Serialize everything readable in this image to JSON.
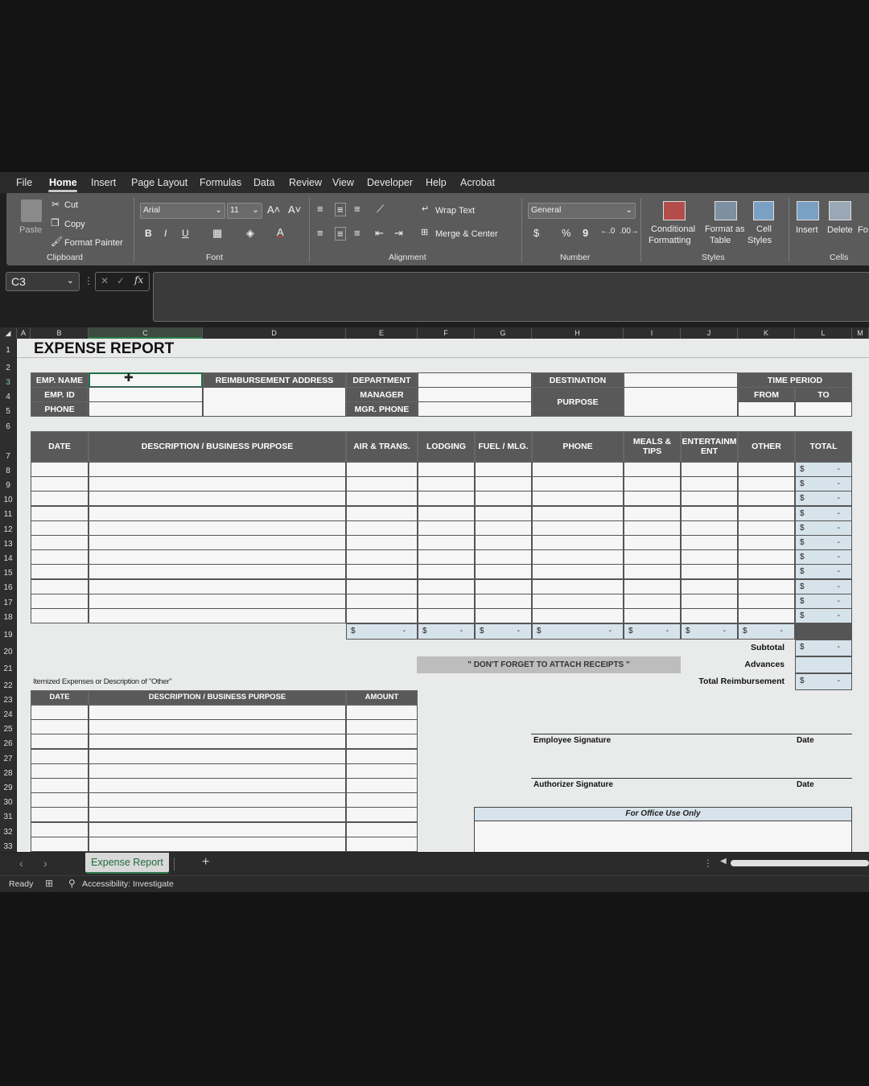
{
  "menu": [
    "File",
    "Home",
    "Insert",
    "Page Layout",
    "Formulas",
    "Data",
    "Review",
    "View",
    "Developer",
    "Help",
    "Acrobat"
  ],
  "ribbon": {
    "clipboard": {
      "paste": "Paste",
      "cut": "Cut",
      "copy": "Copy",
      "format_painter": "Format Painter",
      "group": "Clipboard"
    },
    "font": {
      "name": "Arial",
      "size": "11",
      "bold": "B",
      "italic": "I",
      "underline": "U",
      "group": "Font"
    },
    "alignment": {
      "wrap": "Wrap Text",
      "merge": "Merge & Center",
      "group": "Alignment"
    },
    "number": {
      "format": "General",
      "currency": "$",
      "percent": "%",
      "comma": "9",
      "group": "Number"
    },
    "styles": {
      "conditional": "Conditional",
      "conditional2": "Formatting",
      "format_table": "Format as",
      "format_table2": "Table",
      "cell_styles": "Cell",
      "cell_styles2": "Styles",
      "group": "Styles"
    },
    "cells": {
      "insert": "Insert",
      "delete": "Delete",
      "format": "Fo",
      "group": "Cells"
    }
  },
  "formula_bar": {
    "name_box": "C3",
    "fx": "fx",
    "value": ""
  },
  "columns": [
    "A",
    "B",
    "C",
    "D",
    "E",
    "F",
    "G",
    "H",
    "I",
    "J",
    "K",
    "L",
    "M"
  ],
  "rows": [
    "1",
    "2",
    "3",
    "4",
    "5",
    "6",
    "7",
    "8",
    "9",
    "10",
    "11",
    "12",
    "13",
    "14",
    "15",
    "16",
    "17",
    "18",
    "19",
    "20",
    "21",
    "22",
    "23",
    "24",
    "25",
    "26",
    "27",
    "28",
    "29",
    "30",
    "31",
    "32",
    "33"
  ],
  "sheet": {
    "title": "EXPENSE REPORT",
    "info_labels": {
      "emp_name": "EMP. NAME",
      "emp_id": "EMP. ID",
      "phone": "PHONE",
      "reimb_address": "REIMBURSEMENT ADDRESS",
      "department": "DEPARTMENT",
      "manager": "MANAGER",
      "mgr_phone": "MGR. PHONE",
      "destination": "DESTINATION",
      "purpose": "PURPOSE",
      "time_period": "TIME PERIOD",
      "from": "FROM",
      "to": "TO"
    },
    "table_headers": [
      "DATE",
      "DESCRIPTION / BUSINESS PURPOSE",
      "AIR & TRANS.",
      "LODGING",
      "FUEL / MLG.",
      "PHONE",
      "MEALS & TIPS",
      "ENTERTAINM ENT",
      "OTHER",
      "TOTAL"
    ],
    "currency": "$",
    "dash": "-",
    "subtotal": "Subtotal",
    "advances": "Advances",
    "total_reimbursement": "Total Reimbursement",
    "receipt_note": "\" DON'T FORGET TO ATTACH RECEIPTS \"",
    "itemized_title": "Itemized Expenses or Description of \"Other\"",
    "itemized_headers": [
      "DATE",
      "DESCRIPTION / BUSINESS PURPOSE",
      "AMOUNT"
    ],
    "employee_signature": "Employee Signature",
    "authorizer_signature": "Authorizer Signature",
    "date_label": "Date",
    "office_use": "For Office Use Only"
  },
  "tabs": {
    "sheet_tab": "Expense Report",
    "add": "+"
  },
  "status": {
    "ready": "Ready",
    "accessibility": "Accessibility: Investigate"
  }
}
